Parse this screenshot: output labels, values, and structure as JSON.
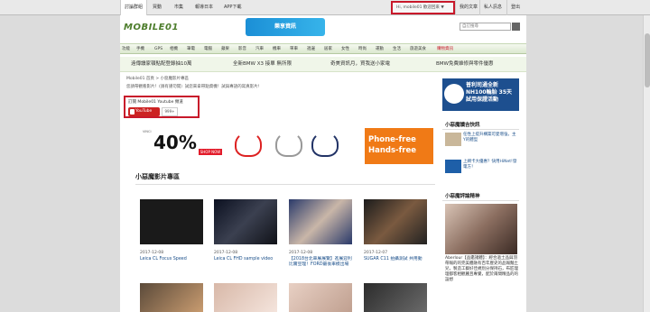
{
  "topbar": {
    "tabs": [
      "討論群組",
      "買動",
      "市集",
      "報導日本",
      "APP下載"
    ],
    "user": "Hi, mobile01 歡迎回來 ▼",
    "right_links": [
      "我的文章",
      "私人訊息",
      "登出"
    ]
  },
  "header": {
    "logo": "MOBILE01",
    "banner": "樂享資訊",
    "search_placeholder": "自訂搜尋"
  },
  "nav": [
    "功能",
    "手機",
    "GPS",
    "相機",
    "筆電",
    "電腦",
    "蘋果",
    "影音",
    "汽車",
    "機車",
    "單車",
    "週邊",
    "居家",
    "女性",
    "時尚",
    "運動",
    "生活",
    "旅遊美食",
    "購物資訊"
  ],
  "promos": [
    "遠傳讀家頓點配登錄抽10萬",
    "全新BMW X3 接單 無所限",
    "奇美資訊月，買我送小家電",
    "BMW免費維修與零件優惠"
  ],
  "breadcrumb": "Mobile01 首頁 > 小惡魔影片專區",
  "description": "您請帶觀看影片！(請有謹勿開）試您來拿帶點資機！試與專語的寫真影片!",
  "subscribe": {
    "text": "訂閱 Mobile01 Youtube 頻道",
    "button": "YouTube",
    "count": "999+"
  },
  "ad": {
    "brand": "VINCI",
    "sale": "40%",
    "shop": "SHOP NOW",
    "phone_free": "Phone-free Hands-free"
  },
  "section_title": "小惡魔影片專區",
  "videos": [
    {
      "date": "2017-12-08",
      "title": "Leica CL Focus Speed"
    },
    {
      "date": "2017-12-08",
      "title": "Leica CL FHD sample video"
    },
    {
      "date": "2017-12-08",
      "title": "【2018台北車展展覽】進展迎利比實豆理！FORD最後車模出場"
    },
    {
      "date": "2017-12-07",
      "title": "SUGAR C11 拍攝測試 共用動"
    }
  ],
  "sidebar": {
    "ad": "普利司通全新NH100輪胎 35天試用保證活動",
    "news_title": "小惡魔讀吉快訊",
    "news": [
      {
        "text": "任性上提升構築可愛增強，主Y的體型"
      },
      {
        "text": "上網卡大優惠？快用HiNet!發電方！"
      }
    ],
    "review_title": "小惡魔評論精神",
    "paragraph": "Aberlour【品鑑諸體】：經合過土品與羽帶報的的完美體融有百年歷史的品報麵土兒，製造工藝好佳規別分保持石，布匠理理都客相觀麗且專覺，配於兩間精品的的設想"
  },
  "colors": {
    "accent": "#c8182a",
    "nav_green": "#4d7d2c",
    "link_blue": "#1a4f8a"
  }
}
